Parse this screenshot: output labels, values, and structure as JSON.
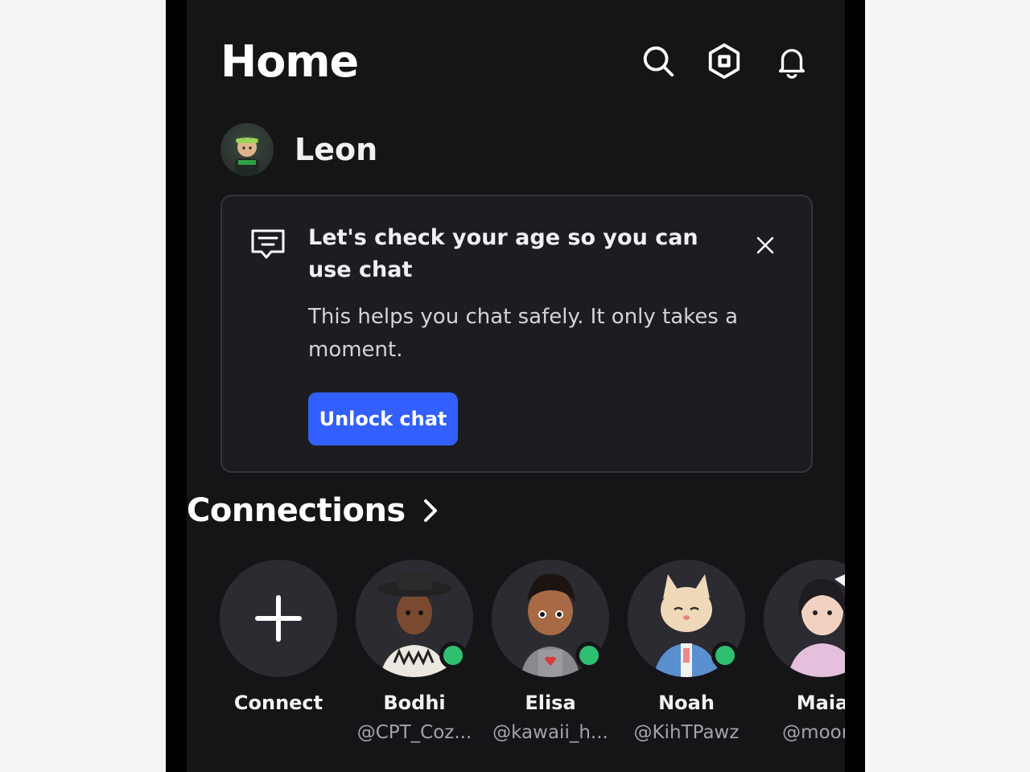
{
  "header": {
    "title": "Home",
    "icons": [
      "search-icon",
      "robux-icon",
      "bell-icon"
    ]
  },
  "user": {
    "name": "Leon"
  },
  "age_check_card": {
    "icon": "chat-message-icon",
    "title": "Let's check your age so you can use chat",
    "body": "This helps you chat safely. It only takes a moment.",
    "button_label": "Unlock chat",
    "close_icon": "close-icon"
  },
  "connections": {
    "title": "Connections",
    "items": [
      {
        "name": "Connect",
        "handle": "",
        "online": false
      },
      {
        "name": "Bodhi",
        "handle": "@CPT_Coz...",
        "online": true
      },
      {
        "name": "Elisa",
        "handle": "@kawaii_h...",
        "online": true
      },
      {
        "name": "Noah",
        "handle": "@KihTPawz",
        "online": true
      },
      {
        "name": "Maia",
        "handle": "@moon_",
        "online": false
      }
    ]
  },
  "colors": {
    "screen_bg": "#151518",
    "card_bg": "#1d1d21",
    "accent_blue": "#335fff",
    "online_green": "#2fbf71"
  }
}
